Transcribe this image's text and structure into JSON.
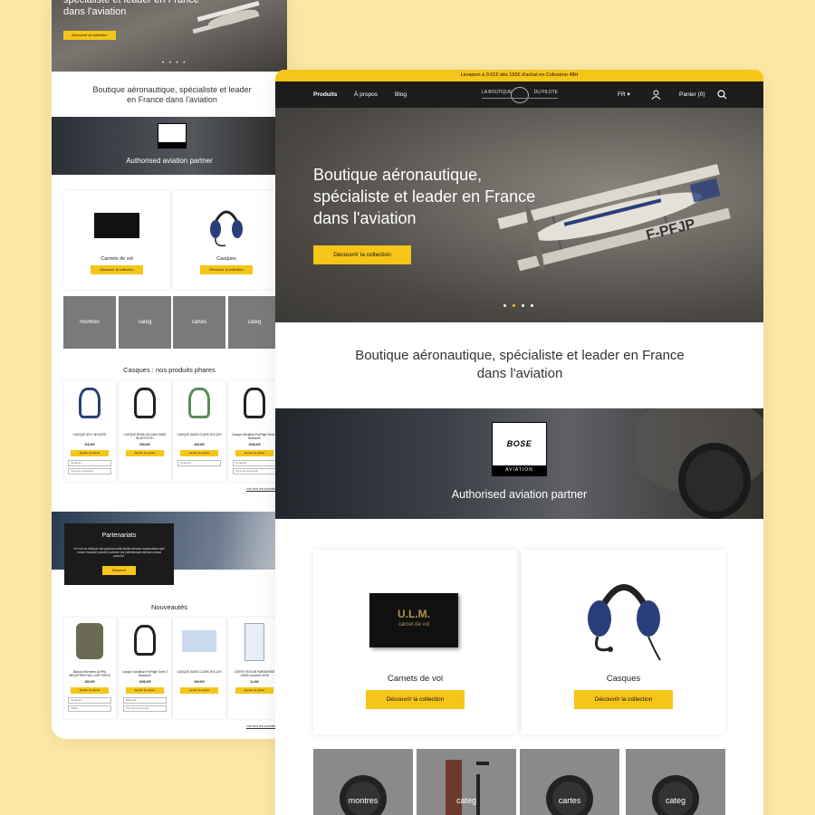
{
  "back_page": {
    "hero_title": "spécialiste et leader en France dans l'aviation",
    "hero_button": "Découvrir la collection",
    "dots": "• • • •",
    "tagline": "Boutique aéronautique, spécialiste et leader en France dans l'aviation",
    "bose_caption": "Authorised aviation partner",
    "categories": [
      {
        "label": "Carnets de vol",
        "button": "Découvrir la collection"
      },
      {
        "label": "Casques",
        "button": "Découvrir la collection"
      }
    ],
    "tiles": [
      "montres",
      "categ",
      "cartes",
      "categ"
    ],
    "products_title": "Casques : nos produits phares",
    "products": [
      {
        "name": "CASQUE UFLY MOUSSE",
        "price": "119,00€",
        "button": "Ajouter au panier",
        "selects": [
          "Couleurs",
          "Type de connexion"
        ]
      },
      {
        "name": "CASQUE BOSE A20 AHM SANS BLUETOOTH",
        "price": "999,00€",
        "button": "Ajouter au panier",
        "selects": []
      },
      {
        "name": "CASQUE DAVID CLARK H10-13H",
        "price": "409,00€",
        "button": "Ajouter au panier",
        "selects": [
          "Couleurs"
        ]
      },
      {
        "name": "Casque d'Aviation ProFlight Série 2 Bluetooth",
        "price": "1049,00€",
        "button": "Ajouter au panier",
        "selects": [
          "Couleurs",
          "Type de connexion"
        ]
      }
    ],
    "see_all": "voir tous les produits",
    "partners_title": "Partenariats",
    "partners_text": "Vel non eu tristique sed gravida mattis facilisi aenean suspendisse eget ornare tincidunt posuere pulvinar nisl pellentesque aenean massa posuere.",
    "partners_button": "Découvrir",
    "news_title": "Nouveautés",
    "news": [
      {
        "name": "Blouson Bombers ALPHA INDUSTRIES MA-1 AIR FORCE",
        "price": "189,00€",
        "button": "Ajouter au panier",
        "selects": [
          "Couleurs",
          "Tailles"
        ]
      },
      {
        "name": "Casque d'Aviation ProFlight Série 2 Bluetooth",
        "price": "1099,00€",
        "button": "Ajouter au panier",
        "selects": [
          "Plafonds",
          "Type de connexion"
        ]
      },
      {
        "name": "CASQUE DAVID CLARK H10-13H",
        "price": "409,00€",
        "button": "Ajouter au panier",
        "selects": []
      },
      {
        "name": "CARTE REGION PARISIENNE 1/250K Automne 2019",
        "price": "11,00€",
        "button": "Ajouter au panier",
        "selects": []
      }
    ],
    "see_all_2": "voir tous les produits"
  },
  "front_page": {
    "promo_bar": "Livraison à 0.01€ dès 150€ d'achat en Colissimo 48H",
    "nav": {
      "produits": "Produits",
      "apropos": "À propos",
      "blog": "Blog",
      "logo_left": "LA BOUTIQUE",
      "logo_right": "DU PILOTE",
      "lang": "FR",
      "cart": "Panier (0)"
    },
    "hero": {
      "title": "Boutique aéronautique, spécialiste et leader en France dans l'aviation",
      "button": "Découvrir la collection",
      "aircraft_registration": "F-PFJP",
      "active_slide": 2,
      "slide_count": 4
    },
    "tagline": "Boutique aéronautique, spécialiste et leader en France dans l'aviation",
    "bose": {
      "brand": "BOSE",
      "sub": "AVIATION",
      "caption": "Authorised aviation partner"
    },
    "categories": [
      {
        "label": "Carnets de vol",
        "button": "Découvrir la collection",
        "product_text": "U.L.M.",
        "product_sub": "carnet de vol"
      },
      {
        "label": "Casques",
        "button": "Découvrir la collection"
      }
    ],
    "tiles": [
      "montres",
      "categ",
      "cartes",
      "categ"
    ]
  },
  "colors": {
    "background": "#fde9a5",
    "accent": "#f5c518",
    "nav": "#1d1d1d"
  }
}
